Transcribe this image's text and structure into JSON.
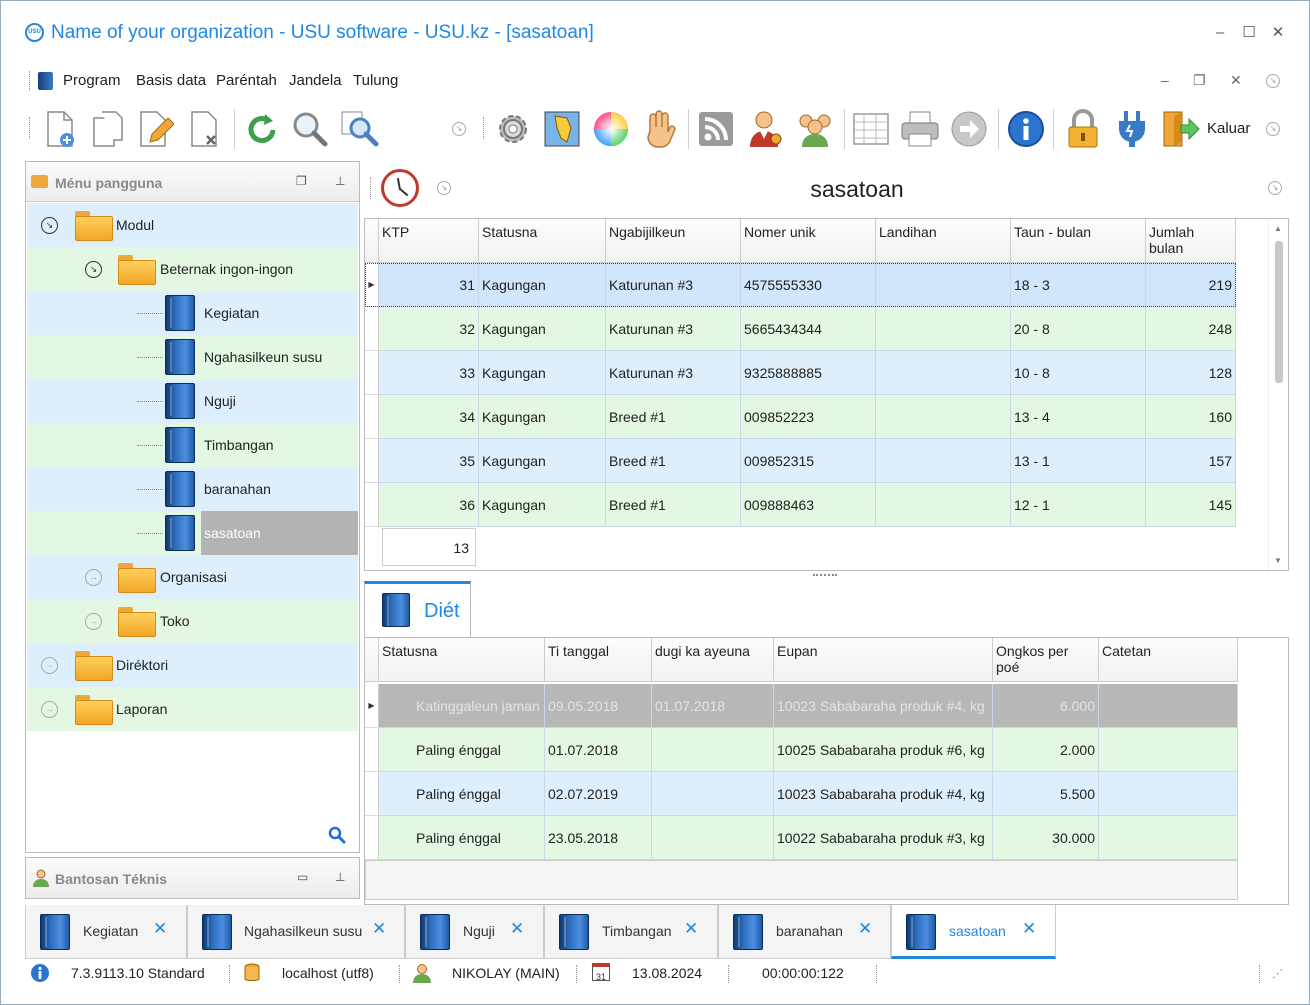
{
  "window": {
    "title": "Name of your organization - USU software - USU.kz - [sasatoan]",
    "logo_text": "USU",
    "accent": "#1e88e5"
  },
  "menu": [
    "Program",
    "Basis data",
    "Paréntah",
    "Jandela",
    "Tulung"
  ],
  "toolbar": {
    "exit_label": "Kaluar",
    "icons": [
      "new-document-icon",
      "copy-icon",
      "edit-icon",
      "delete-icon",
      "refresh-icon",
      "search-icon",
      "advanced-search-icon",
      "settings-icon",
      "map-icon",
      "color-wheel-icon",
      "hand-icon",
      "rss-icon",
      "user-key-icon",
      "users-icon",
      "table-icon",
      "printer-icon",
      "arrow-right-icon",
      "info-icon",
      "lock-icon",
      "plug-icon",
      "exit-icon"
    ]
  },
  "left_panel": {
    "title": "Ménu pangguna",
    "tree": {
      "modul": "Modul",
      "beternak": "Beternak ingon-ingon",
      "items": [
        "Kegiatan",
        "Ngahasilkeun susu",
        "Nguji",
        "Timbangan",
        "baranahan",
        "sasatoan"
      ],
      "organisasi": "Organisasi",
      "toko": "Toko",
      "direktori": "Diréktori",
      "laporan": "Laporan"
    },
    "support_title": "Bantosan Téknis"
  },
  "main": {
    "view_title": "sasatoan",
    "columns": [
      "KTP",
      "Statusna",
      "Ngabijilkeun",
      "Nomer unik",
      "Landihan",
      "Taun - bulan",
      "Jumlah bulan"
    ],
    "rows": [
      {
        "ktp": "31",
        "status": "Kagungan",
        "breed": "Katurunan #3",
        "unique": "4575555330",
        "alias": "",
        "year_month": "18 - 3",
        "months": "219"
      },
      {
        "ktp": "32",
        "status": "Kagungan",
        "breed": "Katurunan #3",
        "unique": "5665434344",
        "alias": "",
        "year_month": "20 - 8",
        "months": "248"
      },
      {
        "ktp": "33",
        "status": "Kagungan",
        "breed": "Katurunan #3",
        "unique": "9325888885",
        "alias": "",
        "year_month": "10 - 8",
        "months": "128"
      },
      {
        "ktp": "34",
        "status": "Kagungan",
        "breed": "Breed #1",
        "unique": "009852223",
        "alias": "",
        "year_month": "13 - 4",
        "months": "160"
      },
      {
        "ktp": "35",
        "status": "Kagungan",
        "breed": "Breed #1",
        "unique": "009852315",
        "alias": "",
        "year_month": "13 - 1",
        "months": "157"
      },
      {
        "ktp": "36",
        "status": "Kagungan",
        "breed": "Breed #1",
        "unique": "009888463",
        "alias": "",
        "year_month": "12 - 1",
        "months": "145"
      }
    ],
    "count": "13"
  },
  "detail": {
    "tab_label": "Diét",
    "columns": [
      "Statusna",
      "Ti tanggal",
      "dugi ka ayeuna",
      "Eupan",
      "Ongkos per poé",
      "Catetan"
    ],
    "rows": [
      {
        "status": "Katinggaleun jaman",
        "from": "09.05.2018",
        "to": "01.07.2018",
        "feed": "10023 Sababaraha produk #4, kg",
        "cost": "6.000",
        "note": ""
      },
      {
        "status": "Paling énggal",
        "from": "01.07.2018",
        "to": "",
        "feed": "10025 Sababaraha produk #6, kg",
        "cost": "2.000",
        "note": ""
      },
      {
        "status": "Paling énggal",
        "from": "02.07.2019",
        "to": "",
        "feed": "10023 Sababaraha produk #4, kg",
        "cost": "5.500",
        "note": ""
      },
      {
        "status": "Paling énggal",
        "from": "23.05.2018",
        "to": "",
        "feed": "10022 Sababaraha produk #3, kg",
        "cost": "30.000",
        "note": ""
      }
    ]
  },
  "tabs": [
    "Kegiatan",
    "Ngahasilkeun susu",
    "Nguji",
    "Timbangan",
    "baranahan",
    "sasatoan"
  ],
  "status": {
    "version": "7.3.9113.10 Standard",
    "db": "localhost (utf8)",
    "user": "NIKOLAY (MAIN)",
    "calendar_day": "31",
    "date": "13.08.2024",
    "timer": "00:00:00:122"
  }
}
